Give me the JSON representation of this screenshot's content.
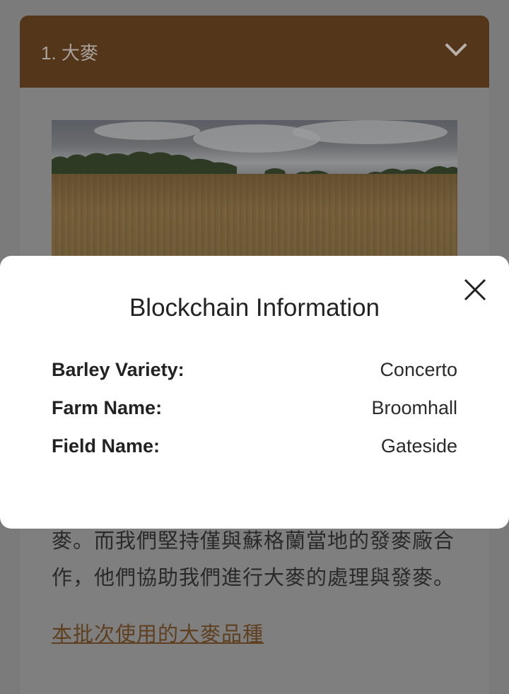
{
  "accordion": {
    "title": "1. 大麥"
  },
  "article": {
    "text_line1": "麥。而我們堅持僅與蘇格蘭當地的發麥廠合",
    "text_line2": "作，他們協助我們進行大麥的處理與發麥。",
    "link_text": "本批次使用的大麥品種"
  },
  "modal": {
    "title": "Blockchain Information",
    "rows": [
      {
        "label": "Barley Variety:",
        "value": "Concerto"
      },
      {
        "label": "Farm Name:",
        "value": "Broomhall"
      },
      {
        "label": "Field Name:",
        "value": "Gateside"
      }
    ]
  },
  "colors": {
    "header_brown": "#54361a",
    "overlay_gray": "#7b7b7b",
    "modal_bg": "#ffffff"
  },
  "icons": {
    "close": "close-icon",
    "chevron": "chevron-down-icon"
  }
}
